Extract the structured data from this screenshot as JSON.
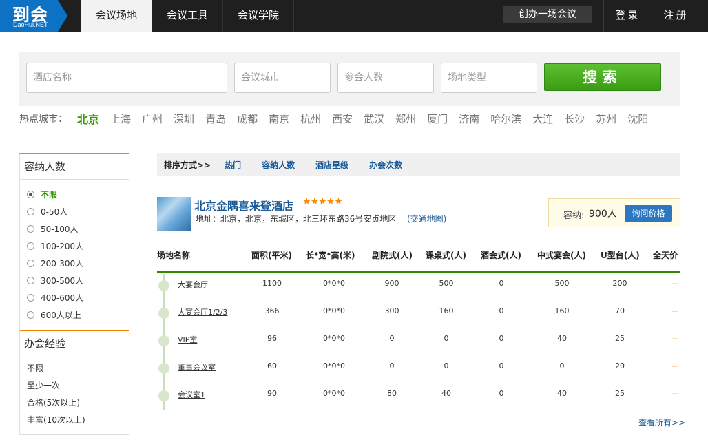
{
  "header": {
    "logo_text": "到会",
    "logo_sub": "DaoHui.NET",
    "nav": [
      {
        "label": "会议场地",
        "active": true
      },
      {
        "label": "会议工具",
        "active": false
      },
      {
        "label": "会议学院",
        "active": false
      }
    ],
    "create_label": "创办一场会议",
    "login_label": "登录",
    "register_label": "注册"
  },
  "search": {
    "hotel_placeholder": "酒店名称",
    "city_placeholder": "会议城市",
    "people_placeholder": "参会人数",
    "type_placeholder": "场地类型",
    "button_label": "搜索"
  },
  "hot_cities": {
    "label": "热点城市：",
    "items": [
      "北京",
      "上海",
      "广州",
      "深圳",
      "青岛",
      "成都",
      "南京",
      "杭州",
      "西安",
      "武汉",
      "郑州",
      "厦门",
      "济南",
      "哈尔滨",
      "大连",
      "长沙",
      "苏州",
      "沈阳"
    ],
    "active": "北京"
  },
  "sidebar": {
    "capacity_title": "容纳人数",
    "capacity_options": [
      "不限",
      "0-50人",
      "50-100人",
      "100-200人",
      "200-300人",
      "300-500人",
      "400-600人",
      "600人以上"
    ],
    "capacity_selected": "不限",
    "experience_title": "办会经验",
    "experience_options": [
      "不限",
      "至少一次",
      "合格(5次以上)",
      "丰富(10次以上)"
    ]
  },
  "sort": {
    "label": "排序方式>>",
    "options": [
      "热门",
      "容纳人数",
      "酒店星级",
      "办会次数"
    ]
  },
  "hotel": {
    "name": "北京金隅喜来登酒店",
    "stars": "★★★★★",
    "address": "地址：北京，北京，东城区，北三环东路36号安贞地区",
    "map_link": "(交通地图)",
    "capacity_label": "容纳:",
    "capacity_value": "900人",
    "price_button": "询问价格"
  },
  "table": {
    "headers": [
      "场地名称",
      "面积(平米)",
      "长*宽*高(米)",
      "剧院式(人)",
      "课桌式(人)",
      "酒会式(人)",
      "中式宴会(人)",
      "U型台(人)",
      "全天价"
    ],
    "rows": [
      [
        "大宴会厅",
        "1100",
        "0*0*0",
        "900",
        "500",
        "0",
        "500",
        "200",
        "--"
      ],
      [
        "大宴会厅1/2/3",
        "366",
        "0*0*0",
        "300",
        "160",
        "0",
        "160",
        "70",
        "--"
      ],
      [
        "VIP室",
        "96",
        "0*0*0",
        "0",
        "0",
        "0",
        "40",
        "25",
        "--"
      ],
      [
        "董事会议室",
        "60",
        "0*0*0",
        "0",
        "0",
        "0",
        "0",
        "20",
        "--"
      ],
      [
        "会议室1",
        "90",
        "0*0*0",
        "80",
        "40",
        "0",
        "40",
        "25",
        "--"
      ]
    ],
    "view_all": "查看所有>>"
  }
}
